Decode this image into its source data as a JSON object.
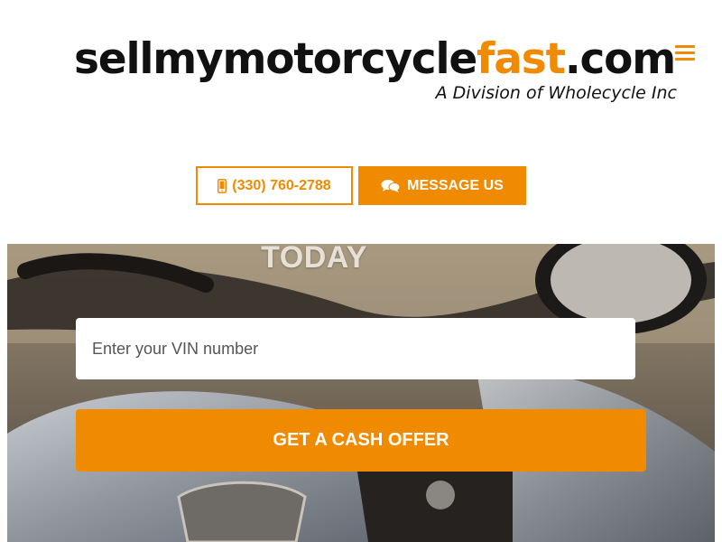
{
  "brand": {
    "name_prefix": "sellmymotorcycle",
    "name_accent": "fast",
    "name_suffix": ".com",
    "tagline": "A Division of Wholecycle Inc",
    "accent_color": "#f08a00"
  },
  "header": {
    "menu_icon": "hamburger-menu-icon"
  },
  "contact": {
    "phone_label": "(330) 760-2788",
    "phone_icon": "mobile-phone-icon",
    "message_label": "MESSAGE US",
    "message_icon": "chat-bubbles-icon"
  },
  "hero": {
    "title": "TODAY",
    "vin_placeholder": "Enter your VIN number",
    "cta_label": "GET A CASH OFFER",
    "background": "motorcycle-photo"
  }
}
